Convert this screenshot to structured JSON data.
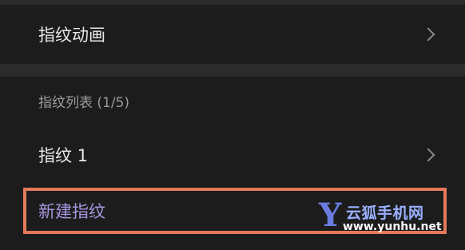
{
  "settings": {
    "fingerprint_animation": {
      "label": "指纹动画"
    },
    "fingerprint_list_header": "指纹列表 (1/5)",
    "fingerprints": [
      {
        "label": "指纹 1"
      }
    ],
    "new_fingerprint": {
      "label": "新建指纹"
    }
  },
  "watermark": {
    "logo": "Y",
    "title": "云狐手机网",
    "url": "www.yunhu.net"
  },
  "colors": {
    "background": "#2b2b2b",
    "card": "#1c1c1c",
    "highlight_border": "#e4795a",
    "accent_text": "#a796df"
  }
}
